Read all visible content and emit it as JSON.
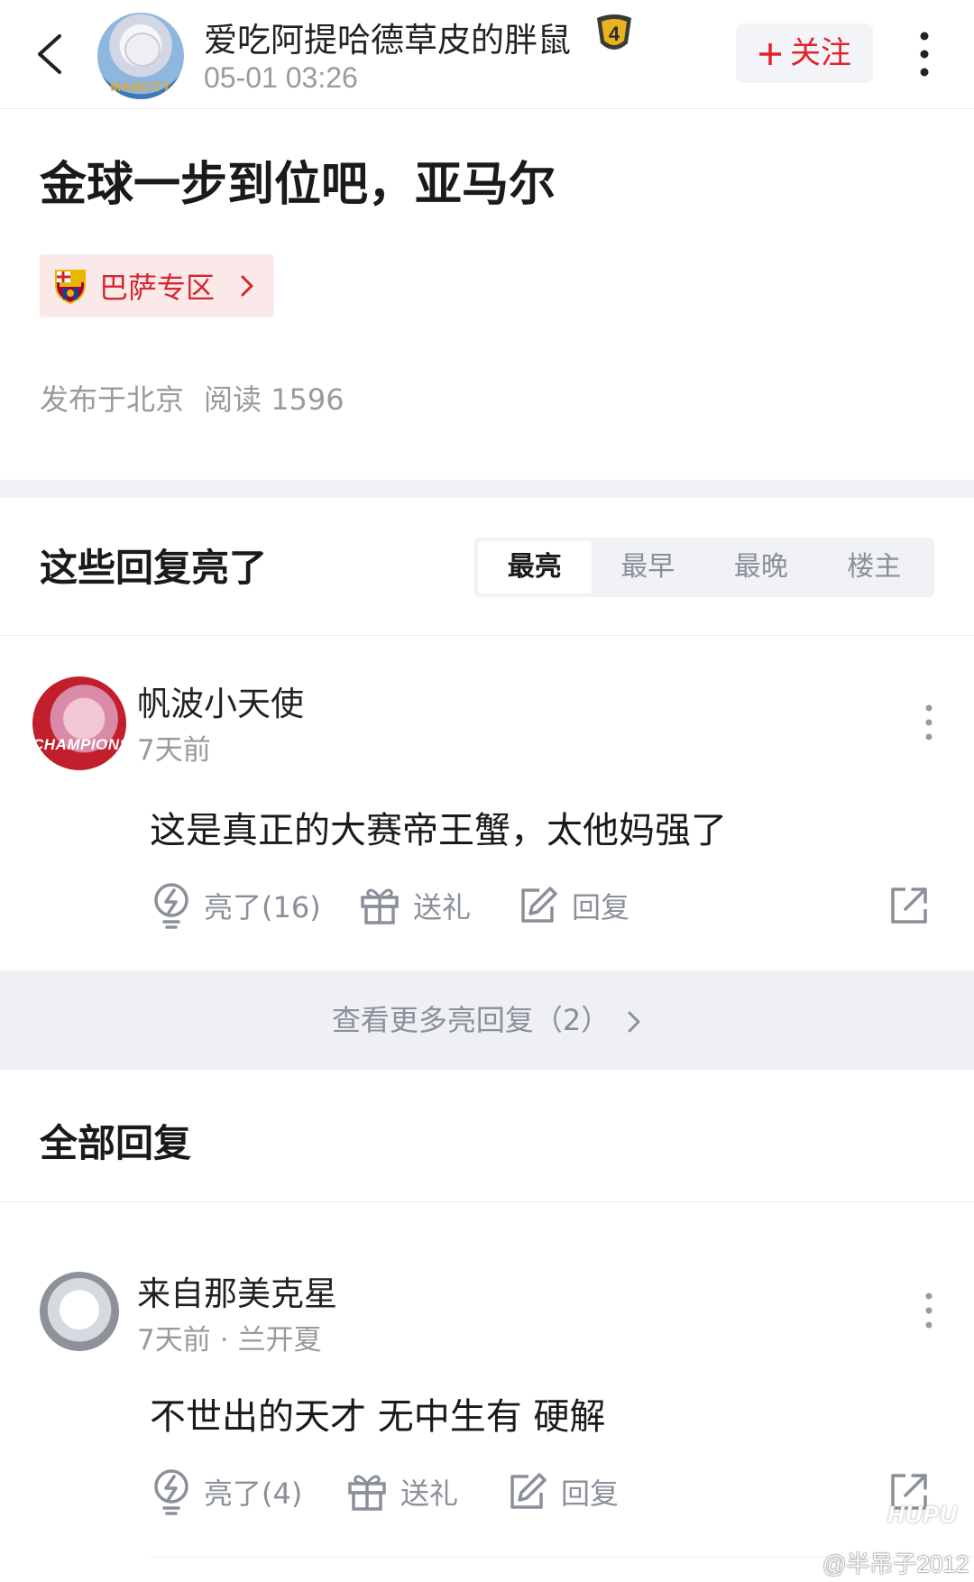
{
  "header": {
    "username": "爱吃阿提哈德草皮的胖鼠",
    "level": "4",
    "post_time": "05-01 03:26",
    "follow_label": "关注",
    "avatar_logo_text": "MANCITY"
  },
  "post": {
    "title": "金球一步到位吧，亚马尔",
    "topic_tag": "巴萨专区",
    "location": "发布于北京",
    "reads": "阅读 1596"
  },
  "bright_replies": {
    "heading": "这些回复亮了",
    "tabs": [
      "最亮",
      "最早",
      "最晚",
      "楼主"
    ],
    "active_tab": "最亮",
    "comments": [
      {
        "username": "帆波小天使",
        "time": "7天前",
        "text": "这是真正的大赛帝王蟹，太他妈强了",
        "like_label": "亮了(16)",
        "gift_label": "送礼",
        "reply_label": "回复",
        "avatar_text": "CHAMPIONS"
      }
    ],
    "more_label": "查看更多亮回复（2）"
  },
  "all_replies": {
    "heading": "全部回复",
    "comments": [
      {
        "username": "来自那美克星",
        "time": "7天前",
        "location": "兰开夏",
        "text": "不世出的天才 无中生有 硬解",
        "like_label": "亮了(4)",
        "gift_label": "送礼",
        "reply_label": "回复"
      }
    ]
  },
  "watermark": {
    "logo": "HUPU",
    "user": "@半吊子2012"
  },
  "colors": {
    "accent_red": "#e0232c",
    "tag_bg": "#fbe9e9",
    "muted_text": "#9a9a9a",
    "section_bg": "#f1f2f5"
  }
}
